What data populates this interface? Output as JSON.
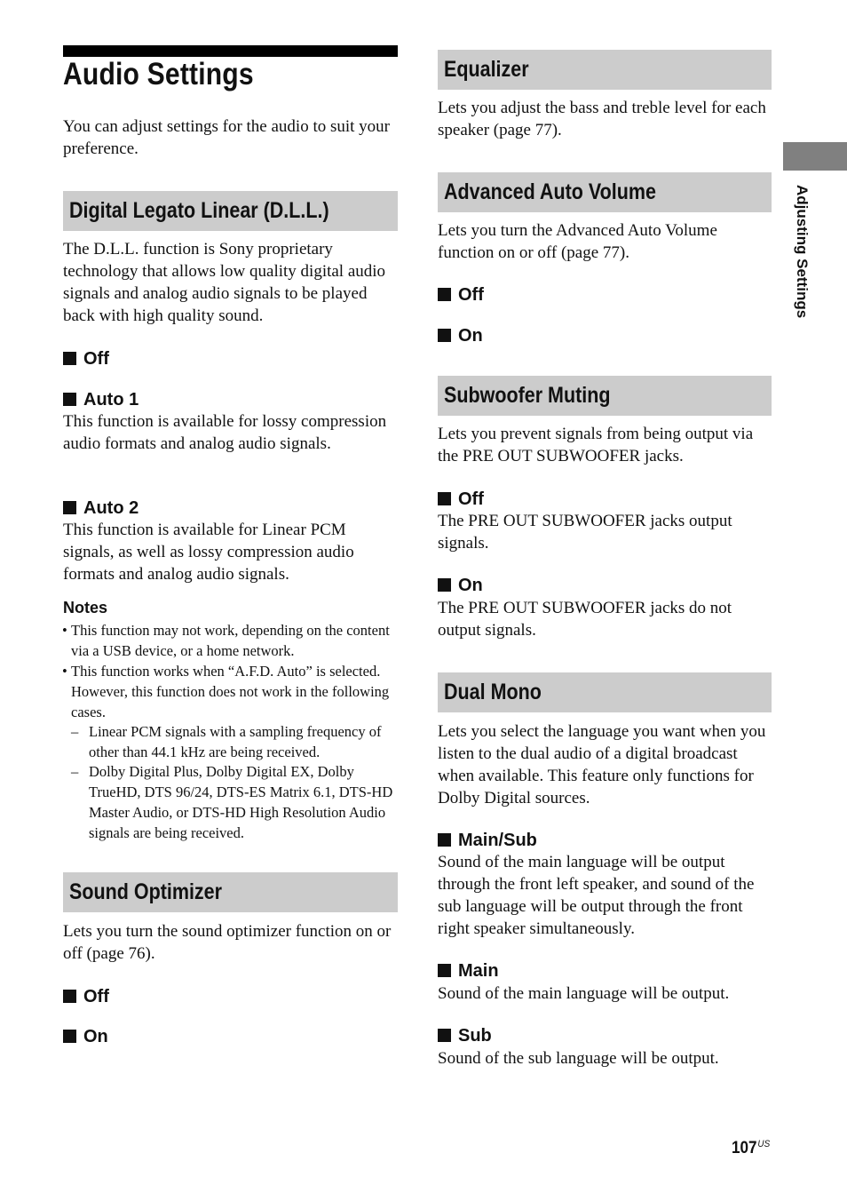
{
  "page": {
    "title": "Audio Settings",
    "intro": "You can adjust settings for the audio to suit your preference.",
    "side_tab_label": "Adjusting Settings",
    "page_number": "107",
    "page_suffix": "US"
  },
  "dll": {
    "heading": "Digital Legato Linear (D.L.L.)",
    "body": "The D.L.L. function is Sony proprietary technology that allows low quality digital audio signals and analog audio signals to be played back with high quality sound.",
    "options": [
      {
        "label": "Off",
        "desc": ""
      },
      {
        "label": "Auto 1",
        "desc": "This function is available for lossy compression audio formats and analog audio signals."
      },
      {
        "label": "Auto 2",
        "desc": "This function is available for Linear PCM signals, as well as lossy compression audio formats and analog audio signals."
      }
    ],
    "notes_heading": "Notes",
    "notes": [
      "This function may not work, depending on the content via a USB device, or a home network.",
      "This function works when “A.F.D. Auto” is selected. However, this function does not work in the following cases."
    ],
    "sub_notes": [
      "Linear PCM signals with a sampling frequency of other than 44.1 kHz are being received.",
      "Dolby Digital Plus, Dolby Digital EX, Dolby TrueHD, DTS 96/24, DTS-ES Matrix 6.1, DTS-HD Master Audio, or DTS-HD High Resolution Audio signals are being received."
    ]
  },
  "sound_optimizer": {
    "heading": "Sound Optimizer",
    "body": "Lets you turn the sound optimizer function on or off (page 76).",
    "options": [
      {
        "label": "Off"
      },
      {
        "label": "On"
      }
    ]
  },
  "equalizer": {
    "heading": "Equalizer",
    "body": "Lets you adjust the bass and treble level for each speaker (page 77)."
  },
  "advanced_auto_volume": {
    "heading": "Advanced Auto Volume",
    "body": "Lets you turn the Advanced Auto Volume function on or off (page 77).",
    "options": [
      {
        "label": "Off"
      },
      {
        "label": "On"
      }
    ]
  },
  "subwoofer_muting": {
    "heading": "Subwoofer Muting",
    "body": "Lets you prevent signals from being output via the PRE OUT SUBWOOFER jacks.",
    "options": [
      {
        "label": "Off",
        "desc": "The PRE OUT SUBWOOFER jacks output signals."
      },
      {
        "label": "On",
        "desc": "The PRE OUT SUBWOOFER jacks do not output signals."
      }
    ]
  },
  "dual_mono": {
    "heading": "Dual Mono",
    "body": "Lets you select the language you want when you listen to the dual audio of a digital broadcast when available. This feature only functions for Dolby Digital sources.",
    "options": [
      {
        "label": "Main/Sub",
        "desc": "Sound of the main language will be output through the front left speaker, and sound of the sub language will be output through the front right speaker simultaneously."
      },
      {
        "label": "Main",
        "desc": "Sound of the main language will be output."
      },
      {
        "label": "Sub",
        "desc": "Sound of the sub language will be output."
      }
    ]
  }
}
